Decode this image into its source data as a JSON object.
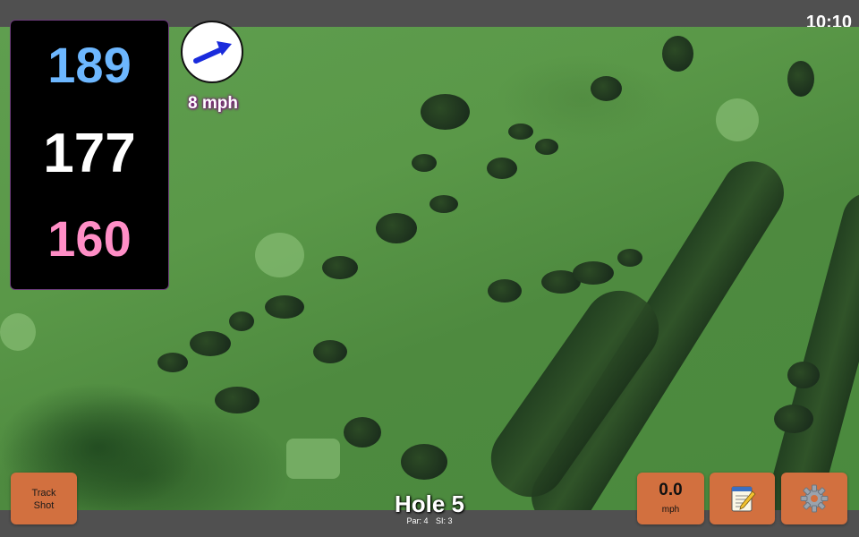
{
  "status_bar": {
    "time": "10:10"
  },
  "distances": {
    "back": "189",
    "middle": "177",
    "front": "160"
  },
  "colors": {
    "back": "#6db7ff",
    "middle": "#ffffff",
    "front": "#ff8ec6",
    "button": "#d2703f",
    "wind_arrow": "#1a2bdc"
  },
  "wind": {
    "speed_label": "8 mph",
    "icon": "arrow-icon"
  },
  "buttons": {
    "track_shot_line1": "Track",
    "track_shot_line2": "Shot",
    "speed_value": "0.0",
    "speed_unit": "mph",
    "notes_icon": "notepad-icon",
    "settings_icon": "gear-icon"
  },
  "hole": {
    "title": "Hole 5",
    "par_label": "Par: 4",
    "si_label": "SI: 3"
  }
}
